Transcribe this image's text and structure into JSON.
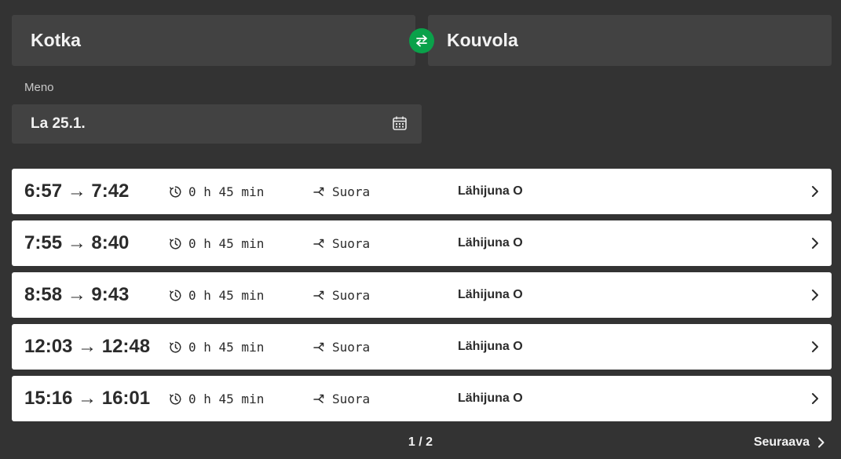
{
  "search": {
    "from": "Kotka",
    "to": "Kouvola",
    "swap_icon": "swap-arrows-icon",
    "date_label": "Meno",
    "date_value": "La 25.1.",
    "calendar_icon": "calendar-icon"
  },
  "results": [
    {
      "times": "6:57 → 7:42",
      "duration": "0 h 45 min",
      "route": "Suora",
      "train": "Lähijuna O"
    },
    {
      "times": "7:55 → 8:40",
      "duration": "0 h 45 min",
      "route": "Suora",
      "train": "Lähijuna O"
    },
    {
      "times": "8:58 → 9:43",
      "duration": "0 h 45 min",
      "route": "Suora",
      "train": "Lähijuna O"
    },
    {
      "times": "12:03 → 12:48",
      "duration": "0 h 45 min",
      "route": "Suora",
      "train": "Lähijuna O"
    },
    {
      "times": "15:16 → 16:01",
      "duration": "0 h 45 min",
      "route": "Suora",
      "train": "Lähijuna O"
    }
  ],
  "pager": {
    "page": "1 / 2",
    "next_label": "Seuraava"
  },
  "colors": {
    "background": "#333333",
    "field": "#424242",
    "accent_green": "#0aa14a",
    "card": "#ffffff",
    "text_dark": "#2b2b2b"
  }
}
